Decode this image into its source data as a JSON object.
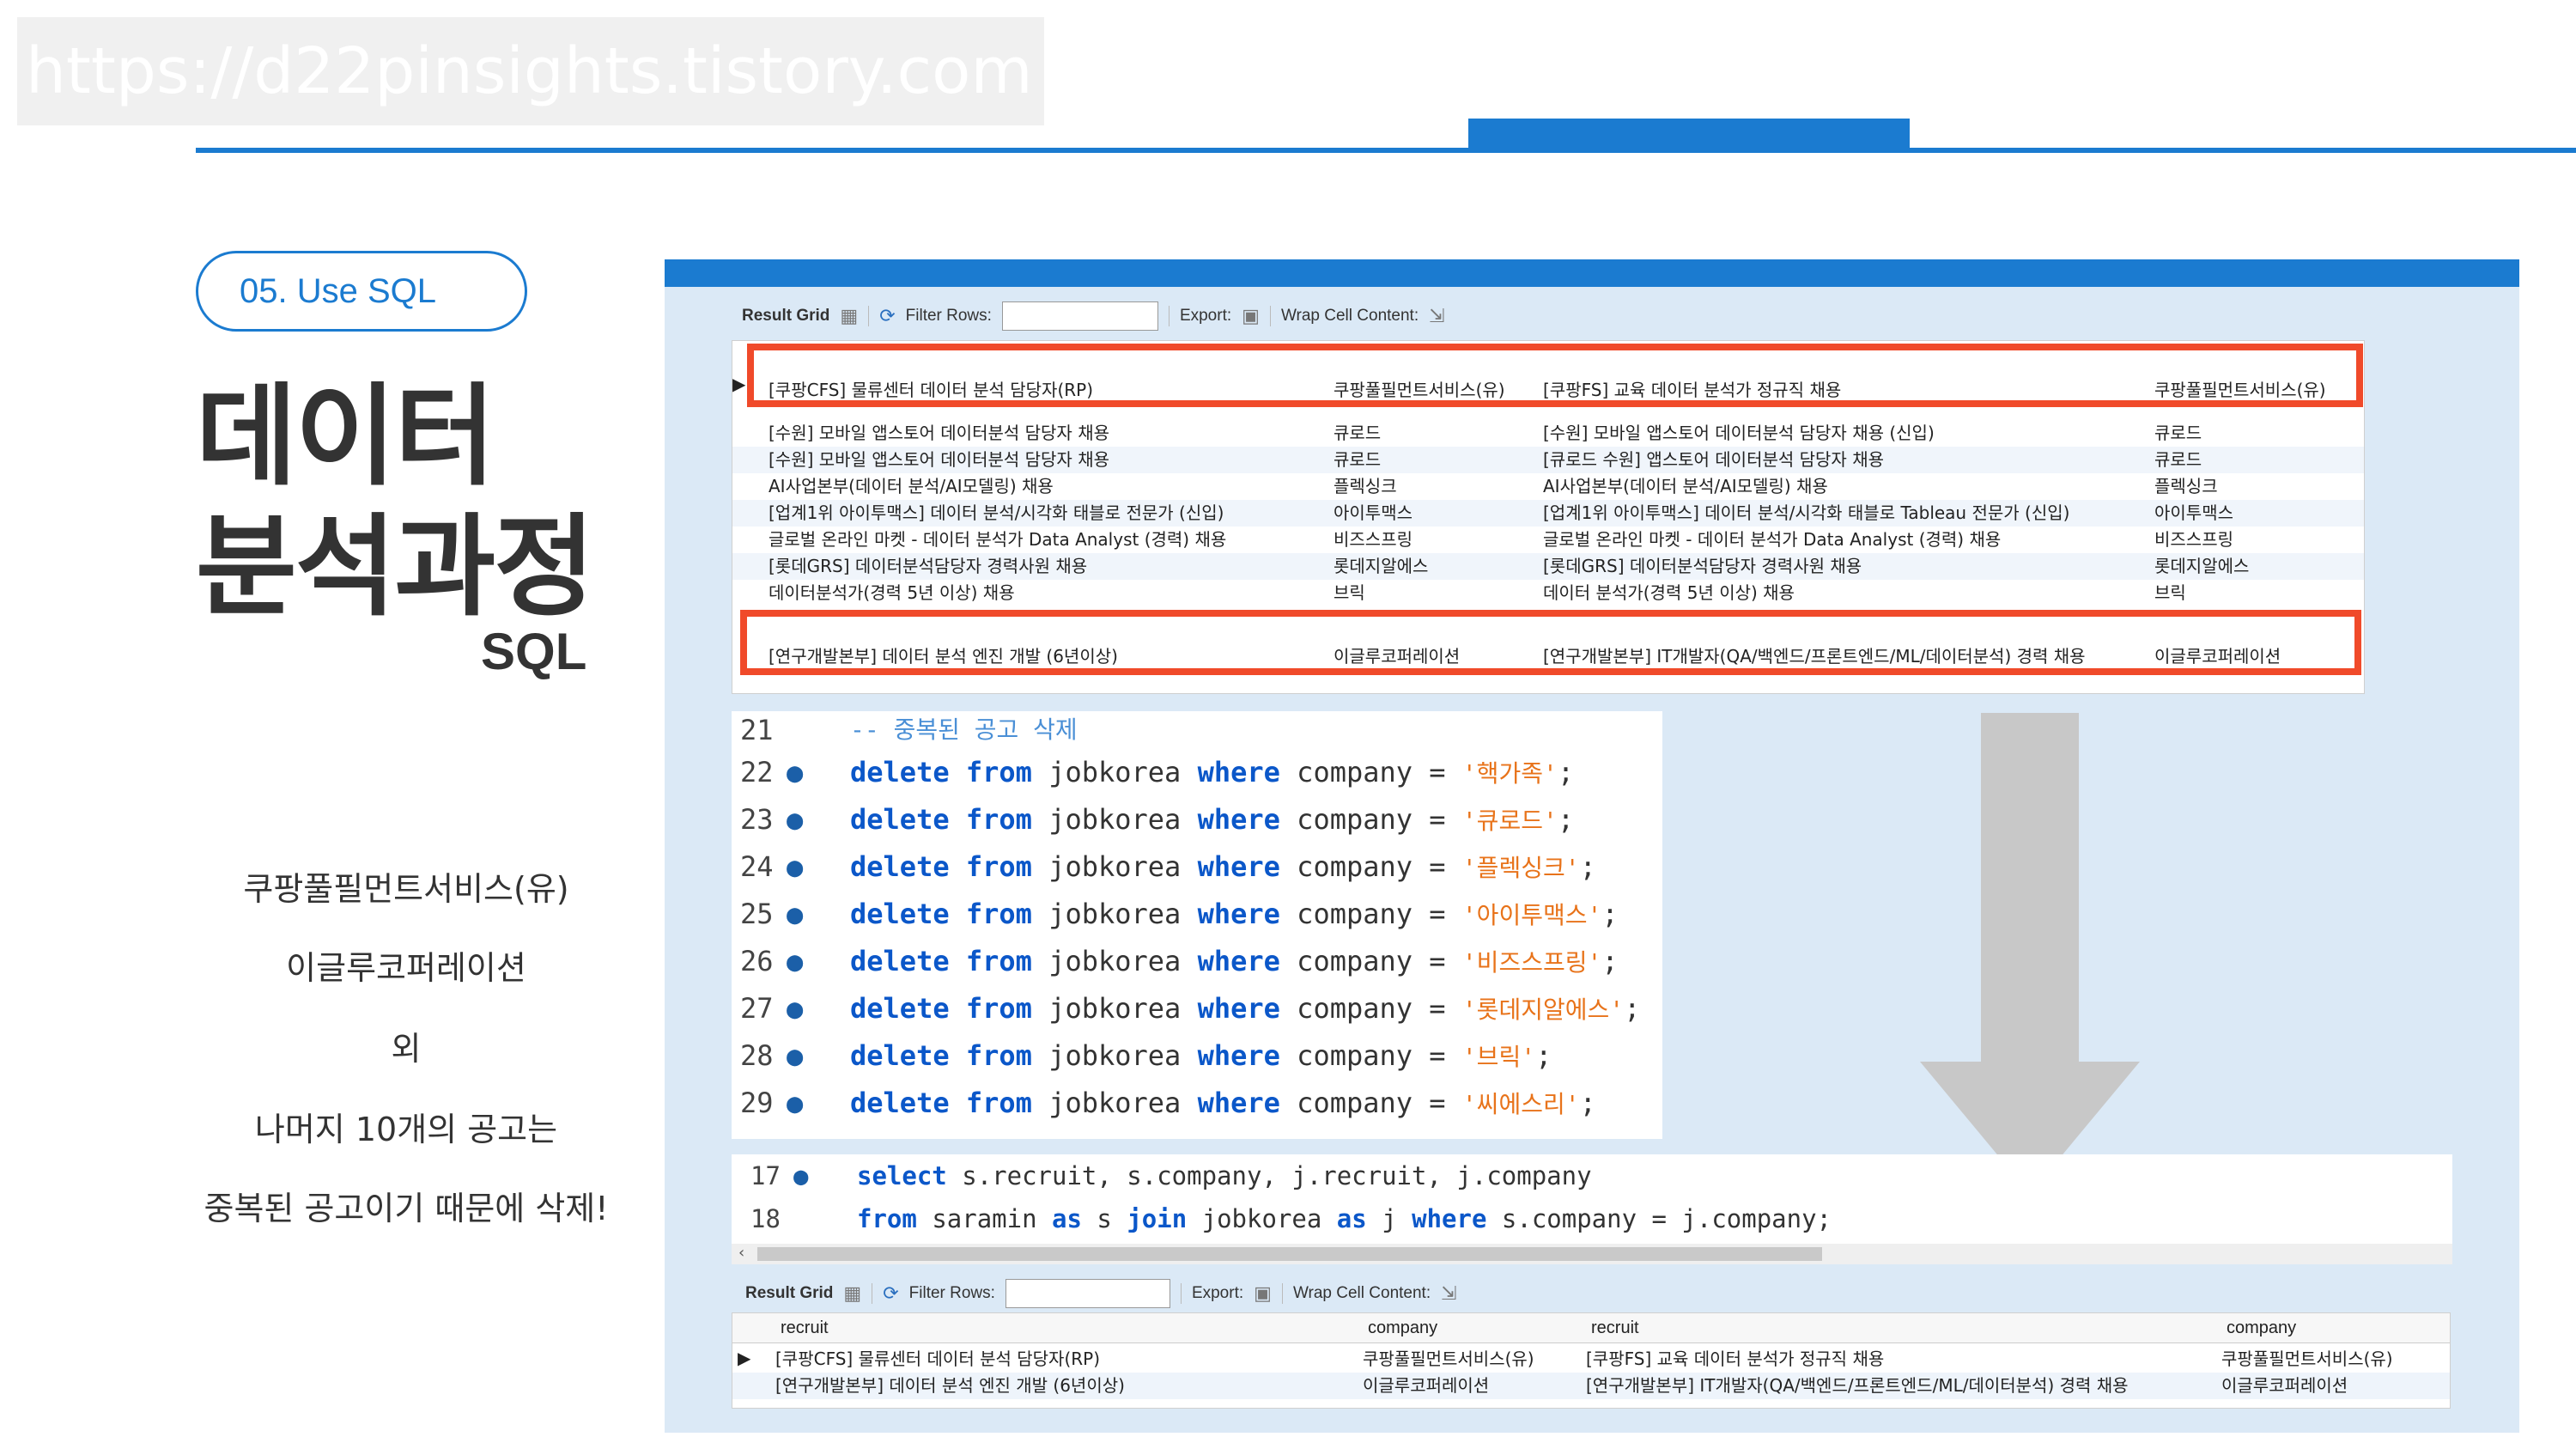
{
  "watermark": "https://d22pinsights.tistory.com",
  "left": {
    "step_label": "05. Use SQL",
    "title_line1": "데이터",
    "title_line2": "분석과정",
    "subtitle": "SQL",
    "desc_lines": [
      "쿠팡풀필먼트서비스(유)",
      "이글루코퍼레이션",
      "외",
      "나머지 10개의 공고는",
      "중복된 공고이기 때문에 삭제!"
    ]
  },
  "grid1": {
    "toolbar": {
      "result_grid": "Result Grid",
      "filter_rows": "Filter Rows:",
      "export": "Export:",
      "wrap": "Wrap Cell Content:"
    },
    "rows": [
      [
        "[쿠팡CFS] 물류센터 데이터 분석 담당자(RP)",
        "쿠팡풀필먼트서비스(유)",
        "[쿠팡FS] 교육 데이터 분석가 정규직 채용",
        "쿠팡풀필먼트서비스(유)"
      ],
      [
        "[수원] 모바일 앱스토어 데이터분석 담당자 채용",
        "큐로드",
        "[수원] 모바일 앱스토어 데이터분석 담당자 채용 (신입)",
        "큐로드"
      ],
      [
        "[수원] 모바일 앱스토어 데이터분석 담당자 채용",
        "큐로드",
        "[큐로드 수원] 앱스토어 데이터분석 담당자 채용",
        "큐로드"
      ],
      [
        "AI사업본부(데이터 분석/AI모델링) 채용",
        "플렉싱크",
        "AI사업본부(데이터 분석/AI모델링) 채용",
        "플렉싱크"
      ],
      [
        "[업계1위 아이투맥스] 데이터 분석/시각화 태블로 전문가 (신입)",
        "아이투맥스",
        "[업계1위 아이투맥스] 데이터 분석/시각화 태블로 Tableau 전문가 (신입)",
        "아이투맥스"
      ],
      [
        "글로벌 온라인 마켓 - 데이터 분석가 Data Analyst (경력) 채용",
        "비즈스프링",
        "글로벌 온라인 마켓 - 데이터 분석가 Data Analyst (경력) 채용",
        "비즈스프링"
      ],
      [
        "[롯데GRS] 데이터분석담당자 경력사원 채용",
        "롯데지알에스",
        "[롯데GRS] 데이터분석담당자 경력사원 채용",
        "롯데지알에스"
      ],
      [
        "데이터분석가(경력 5년 이상) 채용",
        "브릭",
        "데이터 분석가(경력 5년 이상) 채용",
        "브릭"
      ],
      [
        "[연구개발본부] 데이터 분석 엔진 개발 (6년이상)",
        "이글루코퍼레이션",
        "[연구개발본부] IT개발자(QA/백엔드/프론트엔드/ML/데이터분석) 경력 채용",
        "이글루코퍼레이션"
      ]
    ]
  },
  "code1": {
    "comment_line": {
      "num": "21",
      "text": "-- 중복된 공고 삭제"
    },
    "keywords": {
      "delete": "delete",
      "from": "from",
      "where": "where"
    },
    "table": "jobkorea",
    "column": "company",
    "eq": "=",
    "lines": [
      {
        "num": "22",
        "value": "'핵가족'"
      },
      {
        "num": "23",
        "value": "'큐로드'"
      },
      {
        "num": "24",
        "value": "'플렉싱크'"
      },
      {
        "num": "25",
        "value": "'아이투맥스'"
      },
      {
        "num": "26",
        "value": "'비즈스프링'"
      },
      {
        "num": "27",
        "value": "'롯데지알에스'"
      },
      {
        "num": "28",
        "value": "'브릭'"
      },
      {
        "num": "29",
        "value": "'씨에스리'"
      }
    ],
    "semicolon": ";"
  },
  "code2": {
    "line17": {
      "num": "17",
      "kw": "select",
      "rest": "s.recruit, s.company, j.recruit, j.company"
    },
    "line18": {
      "num": "18",
      "kw_from": "from",
      "t1": "saramin",
      "kw_as": "as",
      "a1": "s",
      "kw_join": "join",
      "t2": "jobkorea",
      "a2": "j",
      "kw_where": "where",
      "cond": "s.company = j.company;"
    }
  },
  "grid2": {
    "toolbar": {
      "result_grid": "Result Grid",
      "filter_rows": "Filter Rows:",
      "export": "Export:",
      "wrap": "Wrap Cell Content:"
    },
    "headers": [
      "recruit",
      "company",
      "recruit",
      "company"
    ],
    "rows": [
      [
        "[쿠팡CFS] 물류센터 데이터 분석 담당자(RP)",
        "쿠팡풀필먼트서비스(유)",
        "[쿠팡FS] 교육 데이터 분석가 정규직 채용",
        "쿠팡풀필먼트서비스(유)"
      ],
      [
        "[연구개발본부] 데이터 분석 엔진 개발 (6년이상)",
        "이글루코퍼레이션",
        "[연구개발본부] IT개발자(QA/백엔드/프론트엔드/ML/데이터분석) 경력 채용",
        "이글루코퍼레이션"
      ]
    ]
  }
}
